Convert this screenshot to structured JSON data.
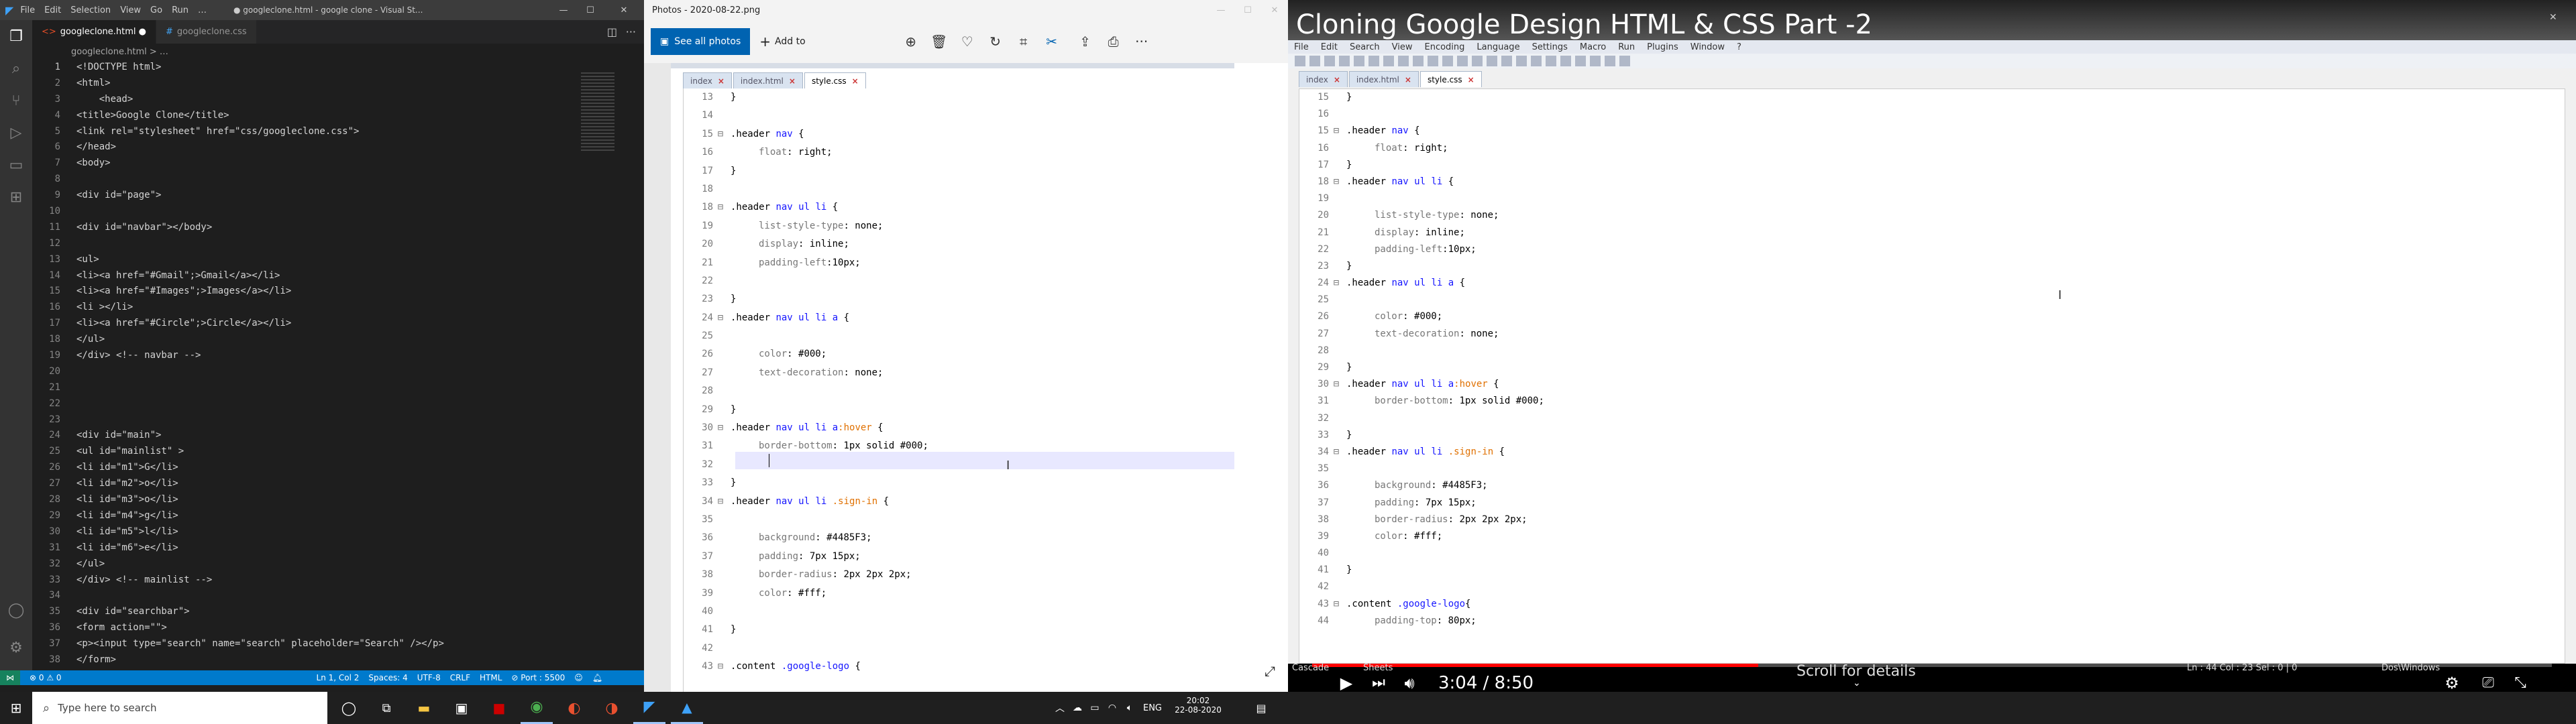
{
  "vscode": {
    "menu": [
      "File",
      "Edit",
      "Selection",
      "View",
      "Go",
      "Run",
      "…"
    ],
    "title": "● googleclone.html - google clone - Visual St...",
    "tabs": [
      {
        "label": "googleclone.html ●"
      },
      {
        "label": "googleclone.css"
      }
    ],
    "breadcrumb": "googleclone.html > …",
    "lines": [
      {
        "n": "1",
        "t": "<!DOCTYPE html>"
      },
      {
        "n": "2",
        "t": "<html>"
      },
      {
        "n": "3",
        "t": "    <head>"
      },
      {
        "n": "4",
        "t": "<title>Google Clone</title>"
      },
      {
        "n": "5",
        "t": "<link rel=\"stylesheet\" href=\"css/googleclone.css\">"
      },
      {
        "n": "6",
        "t": "</head>"
      },
      {
        "n": "7",
        "t": "<body>"
      },
      {
        "n": "8",
        "t": ""
      },
      {
        "n": "9",
        "t": "<div id=\"page\">"
      },
      {
        "n": "10",
        "t": ""
      },
      {
        "n": "11",
        "t": "<div id=\"navbar\"></body>"
      },
      {
        "n": "12",
        "t": ""
      },
      {
        "n": "13",
        "t": "<ul>"
      },
      {
        "n": "14",
        "t": "<li><a href=\"#Gmail\";>Gmail</a></li>"
      },
      {
        "n": "15",
        "t": "<li><a href=\"#Images\";>Images</a></li>"
      },
      {
        "n": "16",
        "t": "<li ></li>"
      },
      {
        "n": "17",
        "t": "<li><a href=\"#Circle\";>Circle</a></li>"
      },
      {
        "n": "18",
        "t": "</ul>"
      },
      {
        "n": "19",
        "t": "</div> <!-- navbar -->"
      },
      {
        "n": "20",
        "t": ""
      },
      {
        "n": "21",
        "t": ""
      },
      {
        "n": "22",
        "t": ""
      },
      {
        "n": "23",
        "t": ""
      },
      {
        "n": "24",
        "t": "<div id=\"main\">"
      },
      {
        "n": "25",
        "t": "<ul id=\"mainlist\" >"
      },
      {
        "n": "26",
        "t": "<li id=\"m1\">G</li>"
      },
      {
        "n": "27",
        "t": "<li id=\"m2\">o</li>"
      },
      {
        "n": "28",
        "t": "<li id=\"m3\">o</li>"
      },
      {
        "n": "29",
        "t": "<li id=\"m4\">g</li>"
      },
      {
        "n": "30",
        "t": "<li id=\"m5\">l</li>"
      },
      {
        "n": "31",
        "t": "<li id=\"m6\">e</li>"
      },
      {
        "n": "32",
        "t": "</ul>"
      },
      {
        "n": "33",
        "t": "</div> <!-- mainlist -->"
      },
      {
        "n": "34",
        "t": ""
      },
      {
        "n": "35",
        "t": "<div id=\"searchbar\">"
      },
      {
        "n": "36",
        "t": "<form action=\"\">"
      },
      {
        "n": "37",
        "t": "<p><input type=\"search\" name=\"search\" placeholder=\"Search\" /></p>"
      },
      {
        "n": "38",
        "t": "</form>"
      }
    ],
    "status": {
      "errors": "⊗ 0 ⚠ 0",
      "pos": "Ln 1, Col 2",
      "spaces": "Spaces: 4",
      "enc": "UTF-8",
      "eol": "CRLF",
      "lang": "HTML",
      "port": "⊘ Port : 5500"
    }
  },
  "photos": {
    "title": "Photos - 2020-08-22.png",
    "see_all": "See all photos",
    "add_to": "Add to",
    "np_tabs": [
      "index",
      "index.html",
      "style.css"
    ],
    "lines": [
      {
        "n": "13",
        "t": "}"
      },
      {
        "n": "14",
        "t": ""
      },
      {
        "n": "15",
        "sel": ".header ",
        "cls": "nav",
        "rest": " {"
      },
      {
        "n": "16",
        "p": "float",
        "v": " right;"
      },
      {
        "n": "17",
        "t": "}"
      },
      {
        "n": "18",
        "t": ""
      },
      {
        "n": "18",
        "sel": ".header ",
        "cls": "nav ul li",
        "rest": " {"
      },
      {
        "n": "19",
        "p": "list-style-type",
        "v": " none;"
      },
      {
        "n": "20",
        "p": "display",
        "v": " inline;"
      },
      {
        "n": "21",
        "p": "padding-left",
        "v": "10px;"
      },
      {
        "n": "22",
        "t": ""
      },
      {
        "n": "23",
        "t": "}"
      },
      {
        "n": "24",
        "sel": ".header ",
        "cls": "nav ul li a",
        "rest": " {"
      },
      {
        "n": "25",
        "t": ""
      },
      {
        "n": "26",
        "p": "color",
        "v": " #000;"
      },
      {
        "n": "27",
        "p": "text-decoration",
        "v": " none;"
      },
      {
        "n": "28",
        "t": ""
      },
      {
        "n": "29",
        "t": "}"
      },
      {
        "n": "30",
        "sel": ".header ",
        "cls": "nav ul li a",
        "pseudo": ":hover",
        "rest": " {"
      },
      {
        "n": "31",
        "p": "border-bottom",
        "v": " 1px solid #000;"
      },
      {
        "n": "32",
        "t": ""
      },
      {
        "n": "33",
        "t": "}"
      },
      {
        "n": "34",
        "sel": ".header ",
        "cls": "nav ul li",
        "pseudo": " .sign-in",
        "rest": " {"
      },
      {
        "n": "35",
        "t": ""
      },
      {
        "n": "36",
        "p": "background",
        "v": " #4485F3;"
      },
      {
        "n": "37",
        "p": "padding",
        "v": " 7px 15px;"
      },
      {
        "n": "38",
        "p": "border-radius",
        "v": " 2px 2px 2px;"
      },
      {
        "n": "39",
        "p": "color",
        "v": " #fff;"
      },
      {
        "n": "40",
        "t": ""
      },
      {
        "n": "41",
        "t": "}"
      },
      {
        "n": "42",
        "t": ""
      },
      {
        "n": "43",
        "sel": ".content ",
        "cls": ".google-logo",
        "rest": " {"
      }
    ]
  },
  "youtube": {
    "title": "Cloning Google Design HTML & CSS Part -2",
    "np_menu": [
      "File",
      "Edit",
      "Search",
      "View",
      "Encoding",
      "Language",
      "Settings",
      "Macro",
      "Run",
      "Plugins",
      "Window",
      "?"
    ],
    "np_tabs": [
      "index",
      "index.html",
      "style.css"
    ],
    "lines": [
      {
        "n": "15",
        "t": "}"
      },
      {
        "n": "16",
        "t": ""
      },
      {
        "n": "15",
        "sel": ".header ",
        "cls": "nav",
        "rest": " {"
      },
      {
        "n": "16",
        "p": "float",
        "v": " right;"
      },
      {
        "n": "17",
        "t": "}"
      },
      {
        "n": "18",
        "sel": ".header ",
        "cls": "nav ul li",
        "rest": " {"
      },
      {
        "n": "19",
        "t": ""
      },
      {
        "n": "20",
        "p": "list-style-type",
        "v": " none;"
      },
      {
        "n": "21",
        "p": "display",
        "v": " inline;"
      },
      {
        "n": "22",
        "p": "padding-left",
        "v": "10px;"
      },
      {
        "n": "23",
        "t": "}"
      },
      {
        "n": "24",
        "sel": ".header ",
        "cls": "nav ul li a",
        "rest": " {"
      },
      {
        "n": "25",
        "t": ""
      },
      {
        "n": "26",
        "p": "color",
        "v": " #000;"
      },
      {
        "n": "27",
        "p": "text-decoration",
        "v": " none;"
      },
      {
        "n": "28",
        "t": ""
      },
      {
        "n": "29",
        "t": "}"
      },
      {
        "n": "30",
        "sel": ".header ",
        "cls": "nav ul li a",
        "pseudo": ":hover",
        "rest": " {"
      },
      {
        "n": "31",
        "p": "border-bottom",
        "v": " 1px solid #000;"
      },
      {
        "n": "32",
        "t": ""
      },
      {
        "n": "33",
        "t": "}"
      },
      {
        "n": "34",
        "sel": ".header ",
        "cls": "nav ul li",
        "pseudo": " .sign-in",
        "rest": " {"
      },
      {
        "n": "35",
        "t": ""
      },
      {
        "n": "36",
        "p": "background",
        "v": " #4485F3;"
      },
      {
        "n": "37",
        "p": "padding",
        "v": " 7px 15px;"
      },
      {
        "n": "38",
        "p": "border-radius",
        "v": " 2px 2px 2px;"
      },
      {
        "n": "39",
        "p": "color",
        "v": " #fff;"
      },
      {
        "n": "40",
        "t": ""
      },
      {
        "n": "41",
        "t": "}"
      },
      {
        "n": "42",
        "t": ""
      },
      {
        "n": "43",
        "sel": ".content ",
        "cls": ".google-logo",
        "rest": "{"
      },
      {
        "n": "44",
        "p": "padding-top",
        "v": " 80px;"
      }
    ],
    "time": "3:04 / 8:50",
    "progress": 0.36,
    "scroll": "Scroll for details",
    "status_left": "Cascade",
    "status_mid": "Ln : 44    Col : 23    Sel : 0 | 0",
    "status_right": "Dos\\Windows"
  },
  "taskbar": {
    "search": "Type here to search",
    "lang": "ENG",
    "time": "20:02",
    "date": "22-08-2020"
  },
  "colors": {
    "vs_bg": "#1e1e1e",
    "vs_status": "#007acc",
    "np_selector": "#1515ff",
    "np_pseudo": "#e07000",
    "yt_red": "#ff0000"
  }
}
